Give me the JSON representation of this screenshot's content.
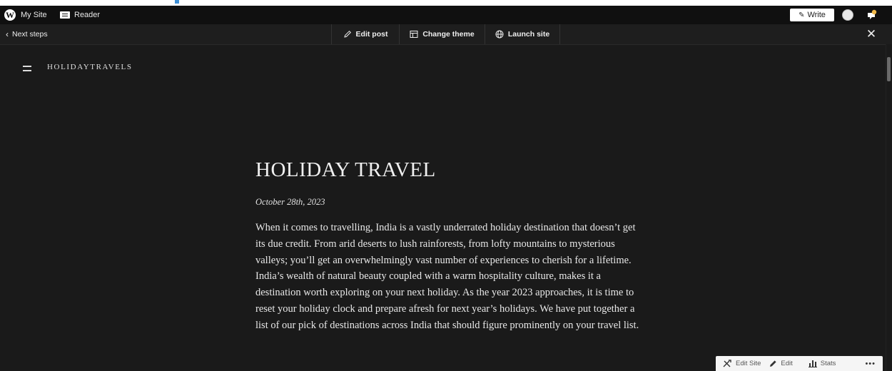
{
  "admin_bar": {
    "my_site_label": "My Site",
    "reader_label": "Reader",
    "write_label": "Write"
  },
  "toolbar": {
    "back_label": "Next steps",
    "edit_post_label": "Edit post",
    "change_theme_label": "Change theme",
    "launch_site_label": "Launch site"
  },
  "site": {
    "name": "HOLIDAYTRAVELS"
  },
  "post": {
    "title": "HOLIDAY TRAVEL",
    "date": "October 28th, 2023",
    "body": "When it comes to travelling, India is a vastly underrated holiday destination that doesn’t get its due credit. From arid deserts to lush rainforests, from lofty mountains to mysterious valleys; you’ll get an overwhelmingly vast number of experiences to cherish for a lifetime. India’s wealth of natural beauty coupled with a warm hospitality culture, makes it a destination worth exploring on your next holiday. As the year 2023 approaches, it is time to reset your holiday clock and prepare afresh for next year’s holidays. We have put together a list of our pick of destinations across India that should figure prominently on your travel list."
  },
  "floating_bar": {
    "edit_site_label": "Edit Site",
    "edit_label": "Edit",
    "stats_label": "Stats"
  },
  "icons": [
    "wordpress-icon",
    "reader-icon",
    "pencil-icon",
    "avatar",
    "notification-icon",
    "chevron-left-icon",
    "layout-icon",
    "globe-icon",
    "close-icon",
    "menu-icon",
    "tools-icon",
    "stats-icon",
    "ellipsis-icon"
  ],
  "colors": {
    "background": "#1a1a1a",
    "admin_bar": "#101010",
    "accent_notification": "#f0b849"
  }
}
